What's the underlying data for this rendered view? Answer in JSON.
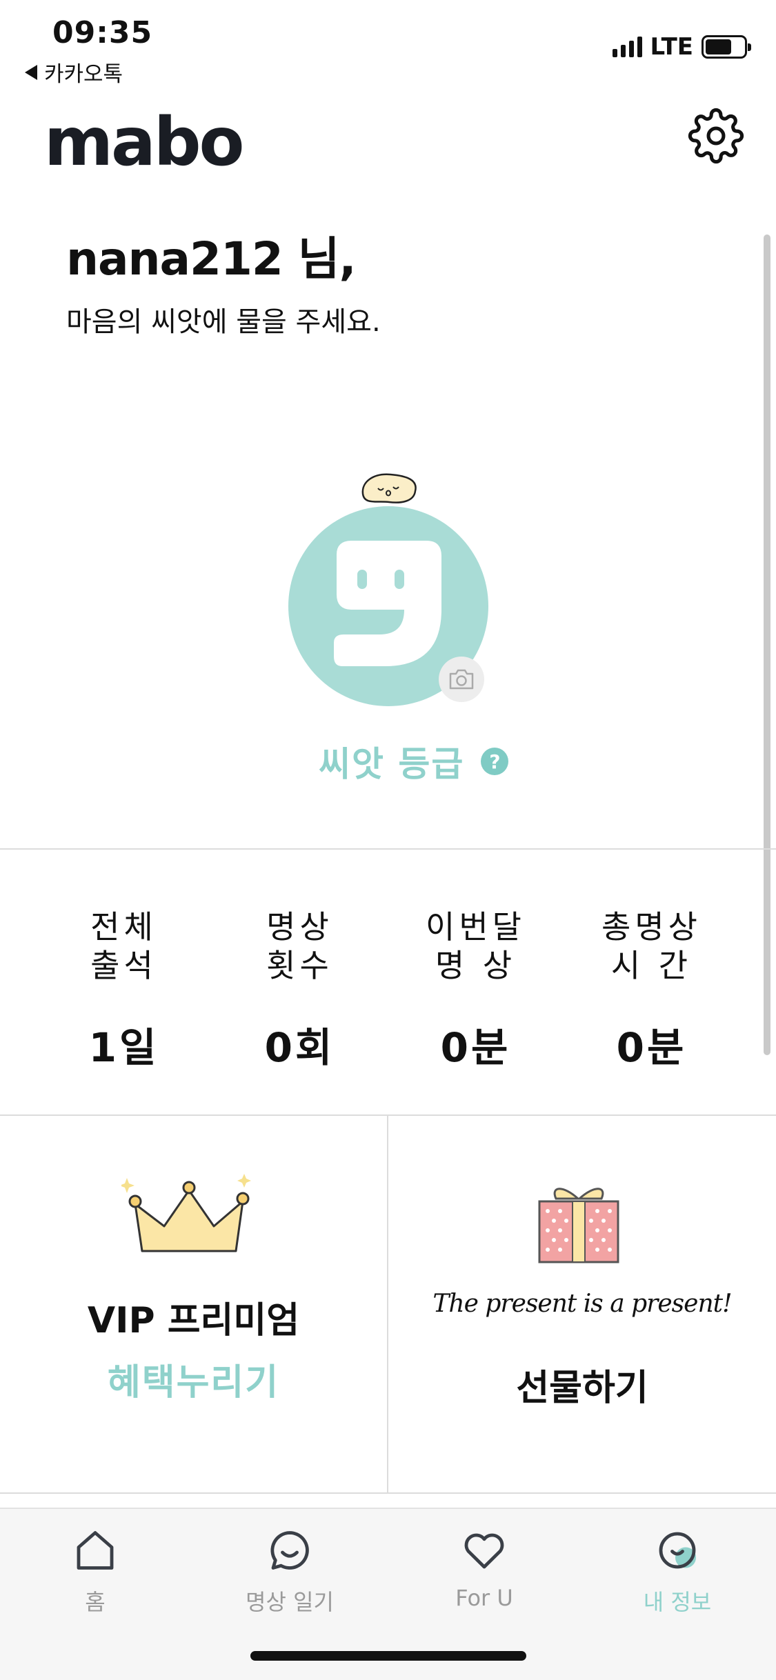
{
  "status_bar": {
    "time": "09:35",
    "back_app": "카카오톡",
    "network": "LTE"
  },
  "header": {
    "logo": "mabo",
    "settings_icon": "gear-icon"
  },
  "greeting": {
    "title": "nana212 님,",
    "subtitle": "마음의 씨앗에 물을 주세요."
  },
  "profile": {
    "grade_label": "씨앗 등급",
    "help_icon": "?"
  },
  "stats": [
    {
      "line1": "전체",
      "line2": "출석",
      "value": "1일"
    },
    {
      "line1": "명상",
      "line2": "횟수",
      "value": "0회"
    },
    {
      "line1": "이번달",
      "line2": "명 상",
      "value": "0분"
    },
    {
      "line1": "총명상",
      "line2": "시 간",
      "value": "0분"
    }
  ],
  "cards": {
    "vip_title": "VIP 프리미엄",
    "vip_link": "혜택누리기",
    "present_text": "The present is a present!",
    "gift_title": "선물하기"
  },
  "tabbar": {
    "home": "홈",
    "diary": "명상 일기",
    "foru": "For U",
    "myinfo": "내 정보"
  },
  "colors": {
    "accent": "#8fd1cb",
    "avatar_bg": "#a9dcd6",
    "text": "#111111",
    "inactive": "#9a9a9a"
  }
}
